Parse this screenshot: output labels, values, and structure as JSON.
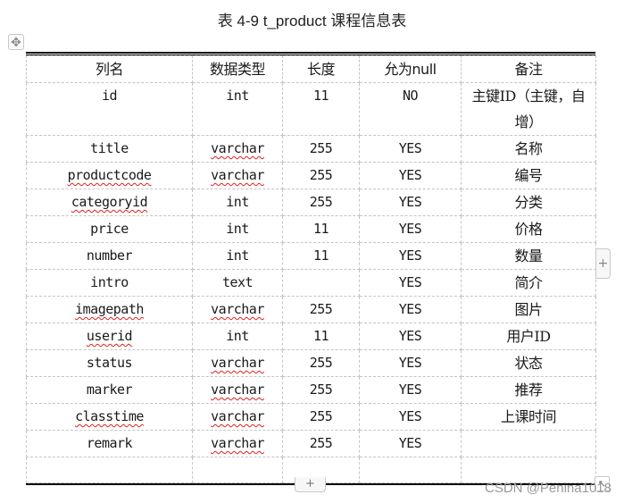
{
  "caption": "表 4-9  t_product  课程信息表",
  "icons": {
    "move_handle": "✥",
    "add_column": "+",
    "add_row": "+",
    "resize_handle": "↖"
  },
  "table": {
    "headers": [
      "列名",
      "数据类型",
      "长度",
      "允为null",
      "备注"
    ],
    "rows": [
      {
        "name": "id",
        "type": "int",
        "length": "11",
        "nullable": "NO",
        "remark": "主键ID（主键，自增）",
        "name_flag": false,
        "type_flag": false
      },
      {
        "name": "title",
        "type": "varchar",
        "length": "255",
        "nullable": "YES",
        "remark": "名称",
        "name_flag": false,
        "type_flag": true
      },
      {
        "name": "productcode",
        "type": "varchar",
        "length": "255",
        "nullable": "YES",
        "remark": "编号",
        "name_flag": true,
        "type_flag": true
      },
      {
        "name": "categoryid",
        "type": "int",
        "length": "255",
        "nullable": "YES",
        "remark": "分类",
        "name_flag": true,
        "type_flag": false
      },
      {
        "name": "price",
        "type": "int",
        "length": "11",
        "nullable": "YES",
        "remark": "价格",
        "name_flag": false,
        "type_flag": false
      },
      {
        "name": "number",
        "type": "int",
        "length": "11",
        "nullable": "YES",
        "remark": "数量",
        "name_flag": false,
        "type_flag": false
      },
      {
        "name": "intro",
        "type": "text",
        "length": "",
        "nullable": "YES",
        "remark": "简介",
        "name_flag": false,
        "type_flag": false
      },
      {
        "name": "imagepath",
        "type": "varchar",
        "length": "255",
        "nullable": "YES",
        "remark": "图片",
        "name_flag": true,
        "type_flag": true
      },
      {
        "name": "userid",
        "type": "int",
        "length": "11",
        "nullable": "YES",
        "remark": "用户ID",
        "name_flag": true,
        "type_flag": false
      },
      {
        "name": "status",
        "type": "varchar",
        "length": "255",
        "nullable": "YES",
        "remark": "状态",
        "name_flag": false,
        "type_flag": true
      },
      {
        "name": "marker",
        "type": "varchar",
        "length": "255",
        "nullable": "YES",
        "remark": "推荐",
        "name_flag": false,
        "type_flag": true
      },
      {
        "name": "classtime",
        "type": "varchar",
        "length": "255",
        "nullable": "YES",
        "remark": "上课时间",
        "name_flag": true,
        "type_flag": true
      },
      {
        "name": "remark",
        "type": "varchar",
        "length": "255",
        "nullable": "YES",
        "remark": "",
        "name_flag": false,
        "type_flag": true
      },
      {
        "name": "",
        "type": "",
        "length": "",
        "nullable": "",
        "remark": "",
        "name_flag": false,
        "type_flag": false
      }
    ]
  },
  "watermark": "CSDN @Penina1018"
}
